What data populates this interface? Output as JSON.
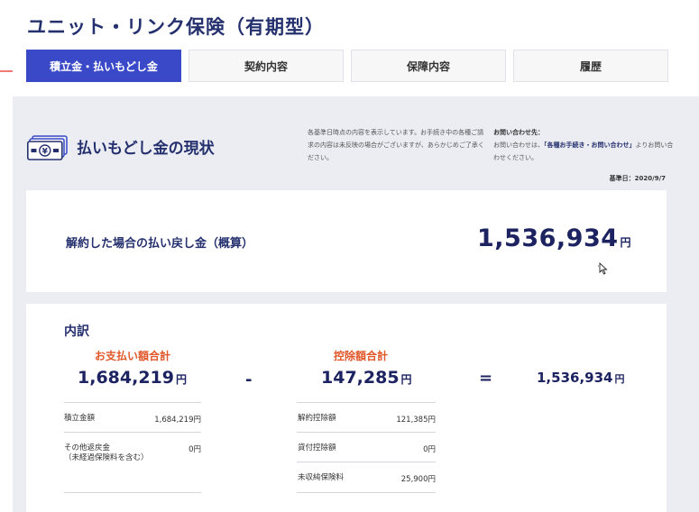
{
  "page": {
    "title": "ユニット・リンク保険（有期型）"
  },
  "tabs": [
    {
      "label": "積立金・払いもどし金",
      "active": true
    },
    {
      "label": "契約内容",
      "active": false
    },
    {
      "label": "保障内容",
      "active": false
    },
    {
      "label": "履歴",
      "active": false
    }
  ],
  "status": {
    "title": "払いもどし金の現状",
    "icon": "money-bill-icon",
    "notice": "各基準日時点の内容を表示しています。お手続き中の各種ご請求の内容は未反映の場合がございますが、あらかじめご了承ください。",
    "contact_head": "お問い合わせ先：",
    "contact_text_pre": "お問い合わせは、",
    "contact_link": "「各種お手続き・お問い合わせ」",
    "contact_text_post": "よりお問い合わせください。",
    "base_date": "基準日：2020/9/7"
  },
  "surrender": {
    "label": "解約した場合の払い戻し金（概算）",
    "amount": "1,536,934",
    "unit": "円"
  },
  "breakdown": {
    "title": "内訳",
    "paid": {
      "head": "お支払い額合計",
      "total": "1,684,219",
      "unit": "円",
      "rows": [
        {
          "label": "積立金額",
          "value": "1,684,219円"
        },
        {
          "label": "その他返戻金\n（未経過保険料を含む）",
          "value": "0円"
        }
      ]
    },
    "minus": "-",
    "deduction": {
      "head": "控除額合計",
      "total": "147,285",
      "unit": "円",
      "rows": [
        {
          "label": "解約控除額",
          "value": "121,385円"
        },
        {
          "label": "貸付控除額",
          "value": "0円"
        },
        {
          "label": "未収純保険料",
          "value": "25,900円"
        }
      ]
    },
    "equals": "=",
    "result": {
      "total": "1,536,934",
      "unit": "円"
    }
  },
  "colors": {
    "brand": "#3949c7",
    "navy": "#25306e",
    "highlight": "#e0572a",
    "panel": "#ecedf3"
  }
}
